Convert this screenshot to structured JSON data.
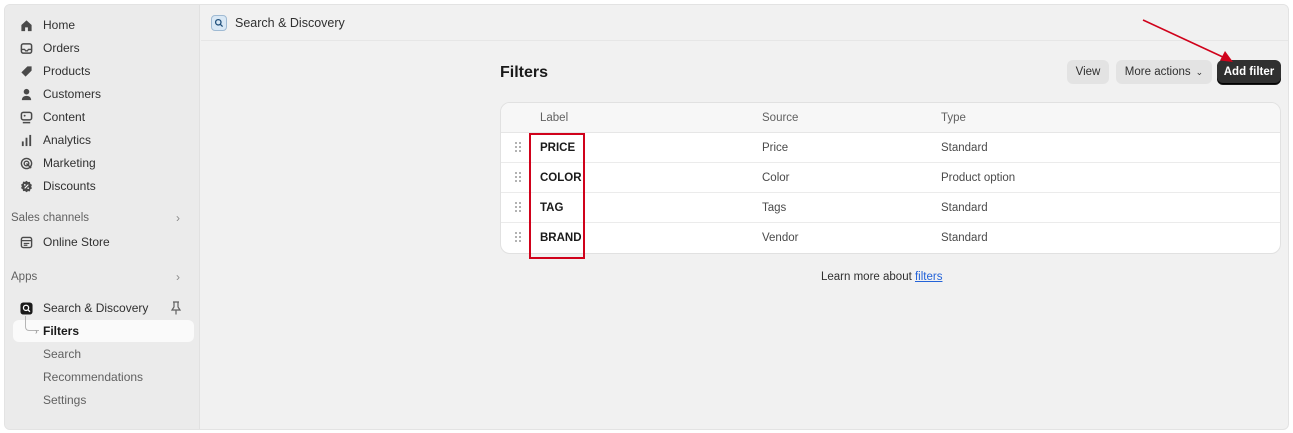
{
  "sidebar": {
    "items": [
      {
        "label": "Home",
        "icon": "home-icon"
      },
      {
        "label": "Orders",
        "icon": "inbox-icon"
      },
      {
        "label": "Products",
        "icon": "tag-icon"
      },
      {
        "label": "Customers",
        "icon": "person-icon"
      },
      {
        "label": "Content",
        "icon": "content-icon"
      },
      {
        "label": "Analytics",
        "icon": "bar-chart-icon"
      },
      {
        "label": "Marketing",
        "icon": "target-icon"
      },
      {
        "label": "Discounts",
        "icon": "discount-icon"
      }
    ],
    "sales_channels_label": "Sales channels",
    "online_store_label": "Online Store",
    "apps_label": "Apps",
    "app_label": "Search & Discovery",
    "app_subitems": [
      "Filters",
      "Search",
      "Recommendations",
      "Settings"
    ],
    "active_subitem": "Filters"
  },
  "topbar": {
    "title": "Search & Discovery"
  },
  "page": {
    "title": "Filters",
    "view_label": "View",
    "more_actions_label": "More actions",
    "add_filter_label": "Add filter"
  },
  "table": {
    "headers": [
      "Label",
      "Source",
      "Type"
    ],
    "rows": [
      {
        "label": "PRICE",
        "source": "Price",
        "type": "Standard"
      },
      {
        "label": "COLOR",
        "source": "Color",
        "type": "Product option"
      },
      {
        "label": "TAG",
        "source": "Tags",
        "type": "Standard"
      },
      {
        "label": "BRAND",
        "source": "Vendor",
        "type": "Standard"
      }
    ]
  },
  "footer": {
    "learn_prefix": "Learn more about ",
    "learn_link": "filters"
  },
  "colors": {
    "primary_button": "#303030",
    "annotation_red": "#d0021b",
    "link": "#2463d8"
  }
}
